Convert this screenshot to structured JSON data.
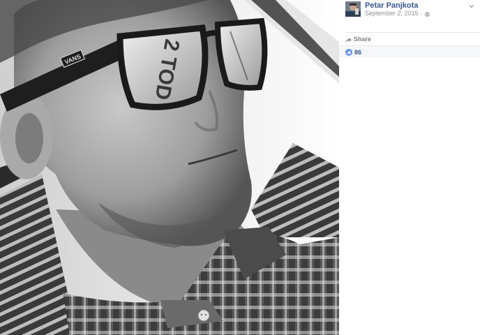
{
  "post": {
    "author_name": "Petar Panjkota",
    "date": "September 2, 2015",
    "separator": "·",
    "privacy_icon": "globe-icon",
    "options_icon": "chevron-down-icon"
  },
  "actions": {
    "share_label": "Share",
    "share_icon": "share-arrow-icon"
  },
  "reactions": {
    "like_count": "86",
    "like_icon": "like-icon",
    "like_color": "#5890ff"
  },
  "photo": {
    "glasses_brand_text": "VANS",
    "lens_reflection_text": "2 TOD"
  },
  "colors": {
    "link_blue": "#365899",
    "meta_gray": "#90949c"
  }
}
